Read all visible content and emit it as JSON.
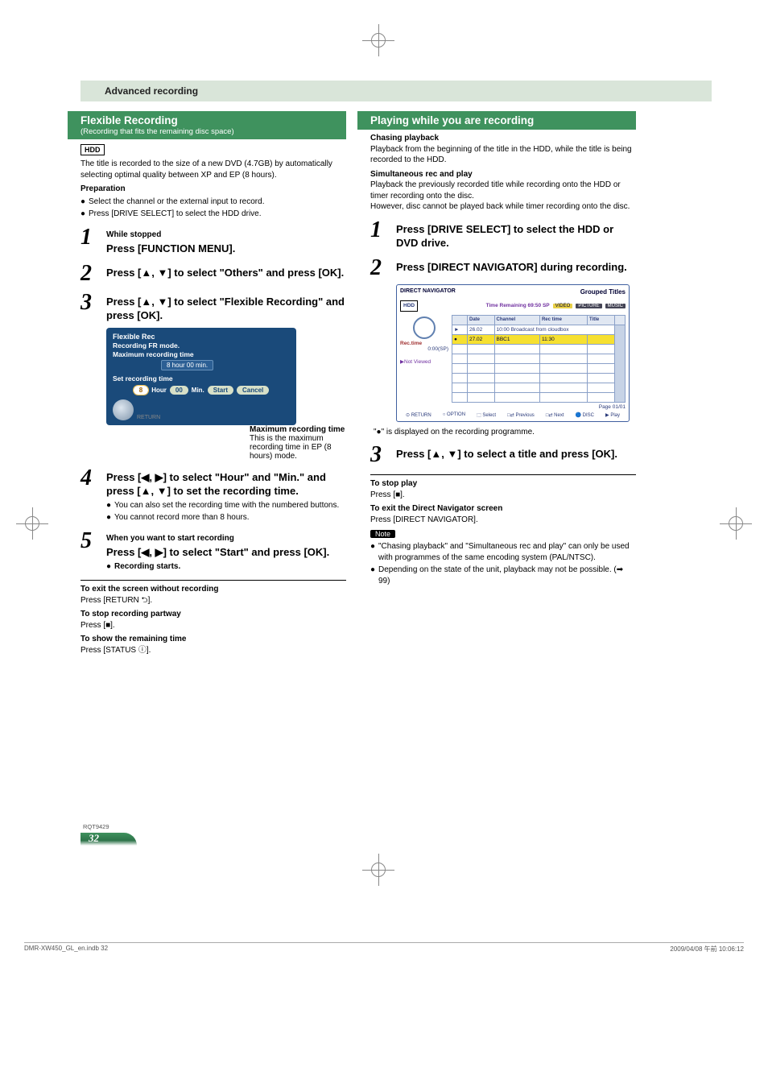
{
  "header_bar": "Advanced recording",
  "col_left": {
    "feature_title": "Flexible Recording",
    "feature_subtitle": "(Recording that fits the remaining disc space)",
    "hdd_tag": "HDD",
    "intro": "The title is recorded to the size of a new DVD (4.7GB) by automatically selecting optimal quality between XP and EP (8 hours).",
    "prep_label": "Preparation",
    "prep_items": [
      "Select the channel or the external input to record.",
      "Press [DRIVE SELECT] to select the HDD drive."
    ],
    "steps": {
      "s1_note": "While stopped",
      "s1": "Press [FUNCTION MENU].",
      "s2": "Press [▲, ▼] to select \"Others\" and press [OK].",
      "s3": "Press [▲, ▼] to select \"Flexible Recording\" and press [OK].",
      "s4": "Press [◀, ▶] to select \"Hour\" and \"Min.\" and press [▲, ▼] to set the recording time.",
      "s4_bullets": [
        "You can also set the recording time with the numbered buttons.",
        "You cannot record more than 8 hours."
      ],
      "s5_note": "When you want to start recording",
      "s5": "Press [◀, ▶] to select \"Start\" and press [OK].",
      "s5_after": "Recording starts."
    },
    "panel": {
      "title": "Flexible Rec",
      "line1": "Recording FR mode.",
      "line2": "Maximum recording time",
      "time_label": "8 hour 00 min.",
      "set_label": "Set recording time",
      "hour_val": "8",
      "hour_lbl": "Hour",
      "min_val": "00",
      "min_lbl": "Min.",
      "start": "Start",
      "cancel": "Cancel",
      "return": "RETURN"
    },
    "caption_bold": "Maximum recording time",
    "caption_body": "This is the maximum recording time in EP (8 hours) mode.",
    "exit1_bold": "To exit the screen without recording",
    "exit1_body": "Press [RETURN ⮌].",
    "exit2_bold": "To stop recording partway",
    "exit2_body": "Press [■].",
    "exit3_bold": "To show the remaining time",
    "exit3_body": "Press [STATUS ⓘ]."
  },
  "col_right": {
    "feature_title": "Playing while you are recording",
    "chasing_bold": "Chasing playback",
    "chasing_body": "Playback from the beginning of the title in the HDD, while the title is being recorded to the HDD.",
    "sim_bold": "Simultaneous rec and play",
    "sim_body1": "Playback the previously recorded title while recording onto the HDD or timer recording onto the disc.",
    "sim_body2": "However, disc cannot be played back while timer recording onto the disc.",
    "steps": {
      "s1": "Press [DRIVE SELECT] to select the HDD or DVD drive.",
      "s2": "Press [DIRECT NAVIGATOR] during recording.",
      "s3": "Press [▲, ▼] to select a title and press [OK]."
    },
    "rec_note": "\"●\" is displayed on the recording programme.",
    "stop_bold": "To stop play",
    "stop_body": "Press [■].",
    "exitdn_bold": "To exit the Direct Navigator screen",
    "exitdn_body": "Press [DIRECT NAVIGATOR].",
    "note_tag": "Note",
    "note_bullets": [
      "\"Chasing playback\" and \"Simultaneous rec and play\" can only be used with programmes of the same encoding system (PAL/NTSC).",
      "Depending on the state of the unit, playback may not be possible. (➡ 99)"
    ],
    "dn_panel": {
      "title_left": "DIRECT NAVIGATOR",
      "title_right": "Grouped Titles",
      "hdd_badge": "HDD",
      "remaining": "Time Remaining  69:50 SP",
      "tab_video": "VIDEO",
      "tab_picture": "PICTURE",
      "tab_music": "MUSIC",
      "cols": [
        "Date",
        "Channel",
        "Rec time",
        "Title"
      ],
      "rows": [
        {
          "date": "26.02",
          "ch": "",
          "rt": "",
          "title": "",
          "h2": "10:00  Broadcast from cloudbox",
          "selected": false,
          "play": "►"
        },
        {
          "date": "27.02",
          "ch": "BBC1",
          "rt": "11:30",
          "title": "",
          "selected": true,
          "rec": "●"
        }
      ],
      "rectime_label": "Rec.time",
      "rectime_val": "0:00(SP)",
      "not_viewed": "▶Not Viewed",
      "page": "Page    01/01",
      "footer_items": [
        "⊙ RETURN",
        "○ OPTION",
        "⬚ Select",
        "□⇄ Previous",
        "□⇄ Next",
        "🔵 DISC",
        "▶ Play"
      ]
    }
  },
  "footer": {
    "rqt": "RQT9429",
    "page_num": "32",
    "indb": "DMR-XW450_GL_en.indb   32",
    "timestamp": "2009/04/08   午前 10:06:12"
  }
}
